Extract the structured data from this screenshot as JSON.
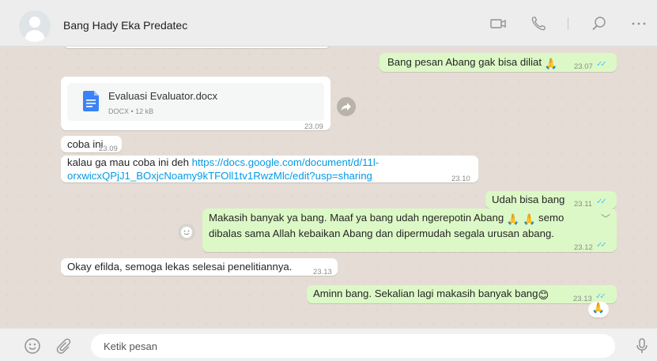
{
  "header": {
    "contact_name": "Bang Hady Eka Predatec",
    "icons": [
      "video-call-icon",
      "voice-call-icon",
      "search-icon",
      "menu-icon"
    ]
  },
  "messages": [
    {
      "dir": "out",
      "text": "Bang pesan Abang gak bisa diliat",
      "emoji": "🙏",
      "time": "23.07",
      "read": true
    },
    {
      "dir": "in",
      "type": "document",
      "file_name": "Evaluasi Evaluator.docx",
      "file_meta": "DOCX • 12 kB",
      "time": "23.09"
    },
    {
      "dir": "in",
      "text": "coba ini",
      "time": "23.09"
    },
    {
      "dir": "in",
      "text": "kalau ga mau coba ini deh ",
      "link": "https://docs.google.com/document/d/11l-orxwicxQPjJ1_BOxjcNoamy9kTFOll1tv1RwzMlc/edit?usp=sharing",
      "link_line1": "https://docs.google.com/document/d/11l-",
      "link_line2": "orxwicxQPjJ1_BOxjcNoamy9kTFOll1tv1RwzMlc/edit?usp=sharing",
      "time": "23.10"
    },
    {
      "dir": "out",
      "text": "Udah bisa bang",
      "time": "23.11",
      "read": true
    },
    {
      "dir": "out",
      "line1": "Makasih banyak ya bang. Maaf ya bang udah ngerepotin Abang",
      "emoji": "🙏 🙏",
      "line1_end": "semo",
      "line2": "dibalas sama Allah kebaikan Abang dan dipermudah segala urusan abang.",
      "time": "23.12",
      "read": true
    },
    {
      "dir": "in",
      "text": "Okay efilda, semoga lekas selesai penelitiannya.",
      "time": "23.13"
    },
    {
      "dir": "out",
      "text": "Aminn bang. Sekalian lagi makasih banyak bang",
      "emoji": "😊",
      "time": "23.13",
      "read": true,
      "reaction": "🙏"
    }
  ],
  "composer": {
    "placeholder": "Ketik pesan"
  },
  "colors": {
    "outgoing_bubble": "#dcf8c6",
    "incoming_bubble": "#ffffff",
    "chat_background": "#e5ddd5",
    "link": "#039be5",
    "read_ticks": "#4fc3f7"
  }
}
